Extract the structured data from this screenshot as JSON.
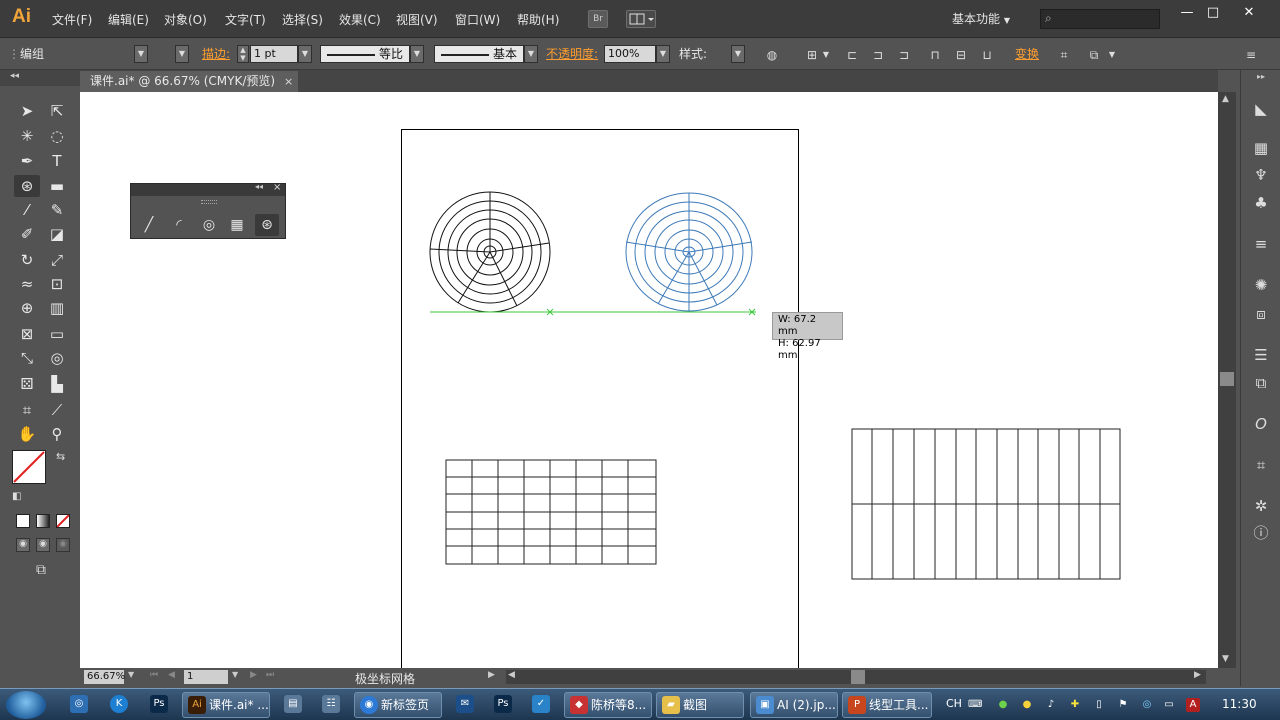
{
  "app": {
    "logo": "Ai"
  },
  "menu": {
    "items": [
      "文件(F)",
      "编辑(E)",
      "对象(O)",
      "文字(T)",
      "选择(S)",
      "效果(C)",
      "视图(V)",
      "窗口(W)",
      "帮助(H)"
    ],
    "bridge_label": "Br",
    "workspace": "基本功能",
    "search_placeholder": ""
  },
  "window_controls": {
    "minimize": "—",
    "restore": "□",
    "close": "✕"
  },
  "control_bar": {
    "selection_label": "编组",
    "stroke_label": "描边:",
    "stroke_weight": "1 pt",
    "profile_label": "等比",
    "brush_label": "基本",
    "opacity_label": "不透明度:",
    "opacity_value": "100%",
    "style_label": "样式:",
    "transform_label": "变换"
  },
  "document_tab": {
    "title": "课件.ai* @ 66.67% (CMYK/预览)",
    "close": "×"
  },
  "tooltip": {
    "width_text": "W: 67.2 mm",
    "height_text": "H: 62.97 mm"
  },
  "status_bar": {
    "zoom": "66.67%",
    "artboard_number": "1",
    "current_tool": "极坐标网格"
  },
  "taskbar": {
    "items": [
      "课件.ai* ...",
      "新标签页",
      "陈桥等8...",
      "截图",
      "AI (2).jp...",
      "线型工具..."
    ],
    "ime": "CH",
    "clock": "11:30"
  },
  "colors": {
    "accent_orange": "#ff9e2e",
    "selection_blue": "#3d7ab8",
    "smart_guide_green": "#3ec73e",
    "ui_dark": "#535353"
  }
}
